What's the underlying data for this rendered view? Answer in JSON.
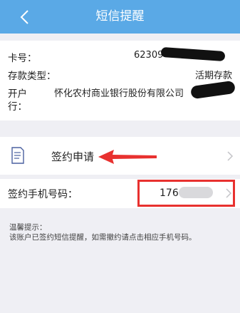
{
  "header": {
    "title": "短信提醒",
    "back_icon": "chevron-left-icon"
  },
  "account": {
    "card_label": "卡号：",
    "card_value": "62309",
    "type_label": "存款类型：",
    "type_value": "活期存款",
    "bank_label_line1": "开户",
    "bank_label_line2": "行：",
    "bank_value": "怀化农村商业银行股份有限公司"
  },
  "sign": {
    "label": "签约申请",
    "icon": "document-icon"
  },
  "phone": {
    "label": "签约手机号码：",
    "value": "176"
  },
  "tips": {
    "title": "温馨提示：",
    "text": "该账户已签约短信提醒，如需撤约请点击相应手机号码。"
  },
  "colors": {
    "header": "#5aa9e6",
    "annotation": "#e8312f",
    "background": "#efeff4"
  }
}
